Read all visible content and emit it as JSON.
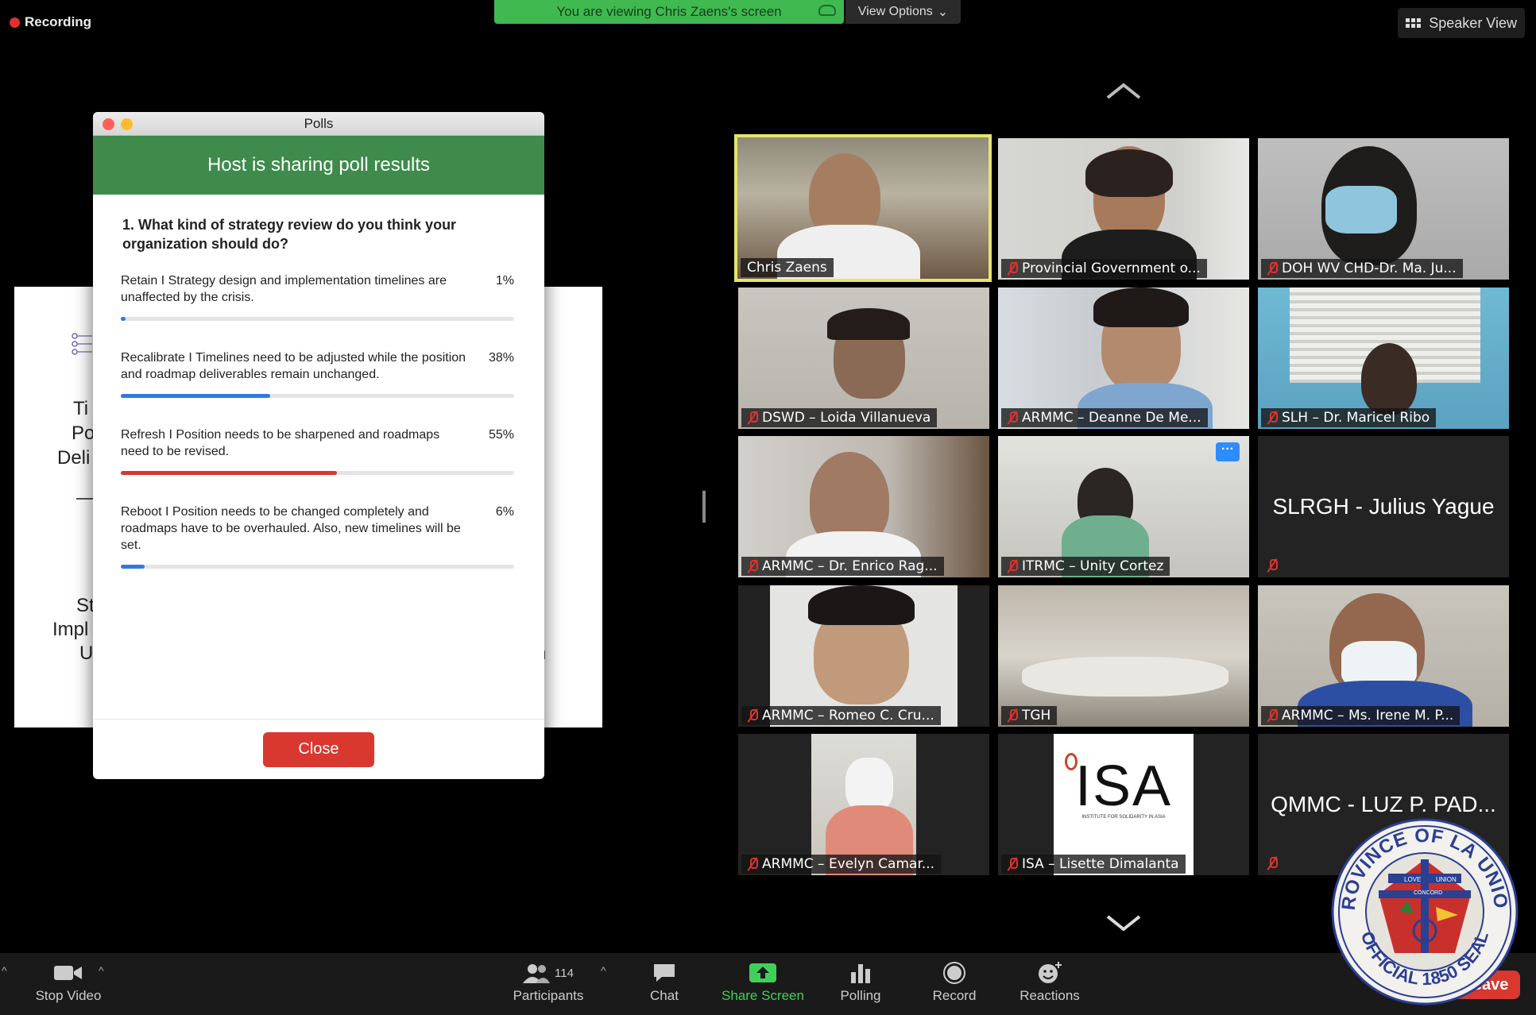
{
  "recording_label": "Recording",
  "banner": {
    "viewing_text": "You are viewing Chris Zaens's screen",
    "view_options": "View Options"
  },
  "speaker_view": "Speaker View",
  "slide": {
    "fragments": [
      "Ti",
      "Po",
      "Deli",
      "St",
      "Impl",
      "U",
      "n"
    ]
  },
  "polls": {
    "window_title": "Polls",
    "header": "Host is sharing poll results",
    "question": "1. What kind of strategy review do you think your organization should do?",
    "options": [
      {
        "text": "Retain I Strategy design and implementation timelines are unaffected by the crisis.",
        "percent_label": "1%",
        "percent": 1,
        "color": "#2d7ae0"
      },
      {
        "text": "Recalibrate I Timelines need to be adjusted while the position and roadmap deliverables remain unchanged.",
        "percent_label": "38%",
        "percent": 38,
        "color": "#2d7ae0"
      },
      {
        "text": "Refresh I Position needs to be sharpened and roadmaps need to be revised.",
        "percent_label": "55%",
        "percent": 55,
        "color": "#d8382e"
      },
      {
        "text": "Reboot I Position needs to be changed completely and roadmaps have to be overhauled. Also, new timelines will be set.",
        "percent_label": "6%",
        "percent": 6,
        "color": "#2d7ae0"
      }
    ],
    "close_label": "Close"
  },
  "participants_tiles": [
    {
      "name": "Chris Zaens",
      "muted": false,
      "active": true
    },
    {
      "name": "Provincial Government o...",
      "muted": true
    },
    {
      "name": "DOH WV CHD-Dr. Ma. Ju...",
      "muted": true
    },
    {
      "name": "DSWD – Loida Villanueva",
      "muted": true
    },
    {
      "name": "ARMMC – Deanne De Me...",
      "muted": true
    },
    {
      "name": "SLH – Dr. Maricel Ribo",
      "muted": true
    },
    {
      "name": "ARMMC – Dr. Enrico Rag...",
      "muted": true
    },
    {
      "name": "ITRMC – Unity Cortez",
      "muted": true
    },
    {
      "name": "SLRGH - Julius Yague",
      "muted": true,
      "no_video": true
    },
    {
      "name": "ARMMC – Romeo C. Cru...",
      "muted": true
    },
    {
      "name": "TGH",
      "muted": true
    },
    {
      "name": "ARMMC – Ms. Irene M. P...",
      "muted": true
    },
    {
      "name": "ARMMC – Evelyn Camar...",
      "muted": true
    },
    {
      "name": "ISA – Lisette Dimalanta",
      "muted": true
    },
    {
      "name": "QMMC - LUZ P. PAD...",
      "muted": true,
      "no_video": true
    }
  ],
  "isa_logo": {
    "text": "ISA",
    "subtitle": "INSTITUTE FOR SOLIDARITY IN ASIA"
  },
  "toolbar": {
    "stop_video": "Stop Video",
    "participants_count": "114",
    "participants": "Participants",
    "chat": "Chat",
    "share_screen": "Share Screen",
    "polling": "Polling",
    "record": "Record",
    "reactions": "Reactions",
    "leave": "Leave"
  },
  "seal": {
    "ring_text": "PROVINCE OF LA UNION",
    "bottom_text": "OFFICIAL 1850 SEAL",
    "banner_left": "LOVE",
    "banner_right": "UNION",
    "banner_mid": "CONCORD"
  },
  "colors": {
    "accent_green": "#3e8b4c",
    "zoom_blue": "#2d8cff",
    "danger_red": "#d8382e",
    "active_speaker": "#e4e56a"
  }
}
